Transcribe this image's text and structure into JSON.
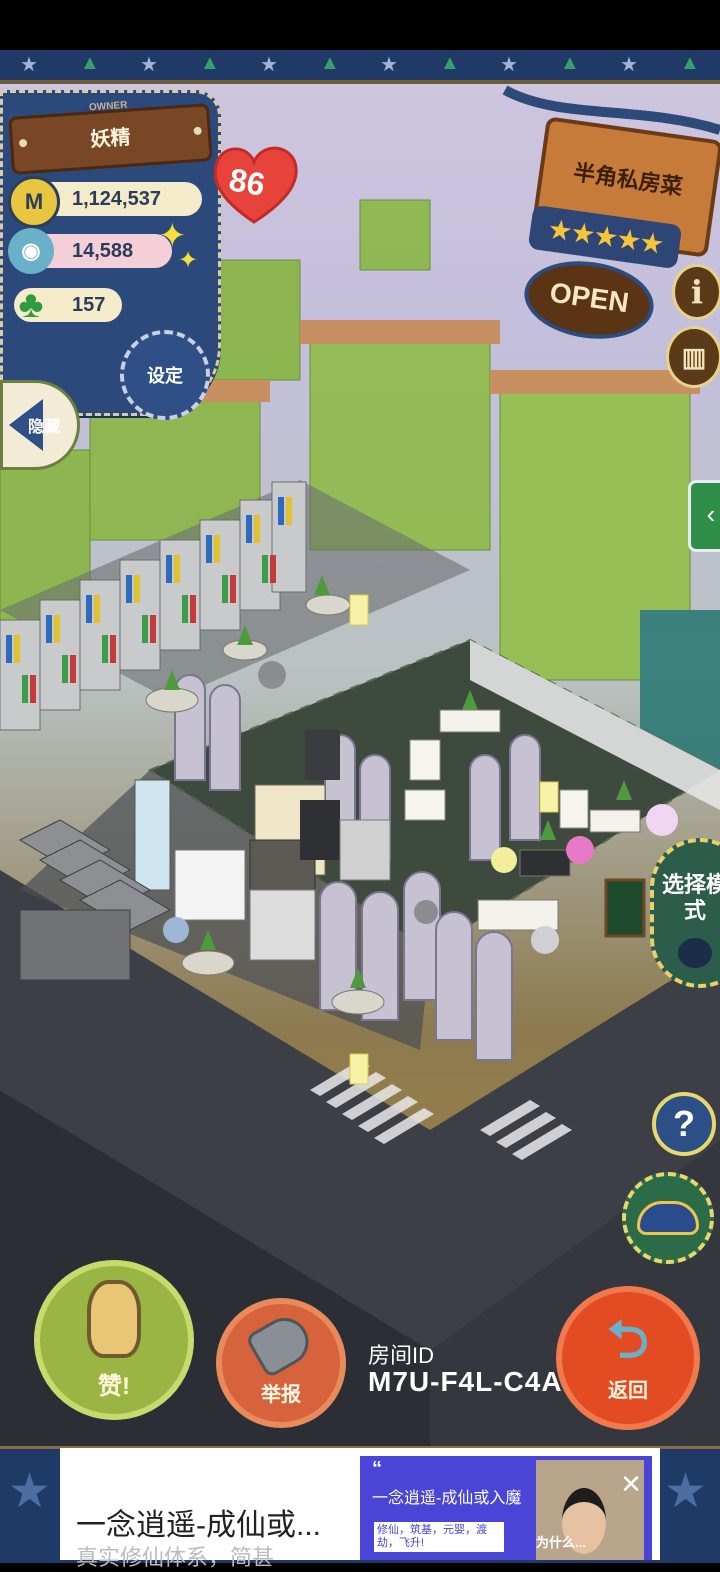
{
  "owner": {
    "caption": "OWNER",
    "name": "妖精",
    "level": "86"
  },
  "stats": {
    "coins": "1,124,537",
    "cuisine": "14,588",
    "clover": "157"
  },
  "buttons": {
    "settings": "设定",
    "hide": "隐藏",
    "mode": "选择模式",
    "help": "?",
    "like": "赞!",
    "report": "举报",
    "back": "返回"
  },
  "shop": {
    "name": "半角私房菜",
    "stars": "★★★★★",
    "status": "OPEN"
  },
  "room": {
    "label": "房间ID",
    "id": "M7U-F4L-C4A"
  },
  "ad": {
    "title": "一念逍遥-成仙或...",
    "subtitle": "真实修仙体系，简甚",
    "image_quote": "“",
    "image_title": "一念逍遥-成仙或入魔",
    "image_sub": "修仙，筑基，元婴，渡劫，飞升!",
    "photo_text": "为什么...",
    "close": "✕"
  },
  "colors": {
    "panel": "#2b4a7b",
    "heart": "#e8433a",
    "like": "#9bb545",
    "report": "#d6633c",
    "back": "#e34b23"
  }
}
